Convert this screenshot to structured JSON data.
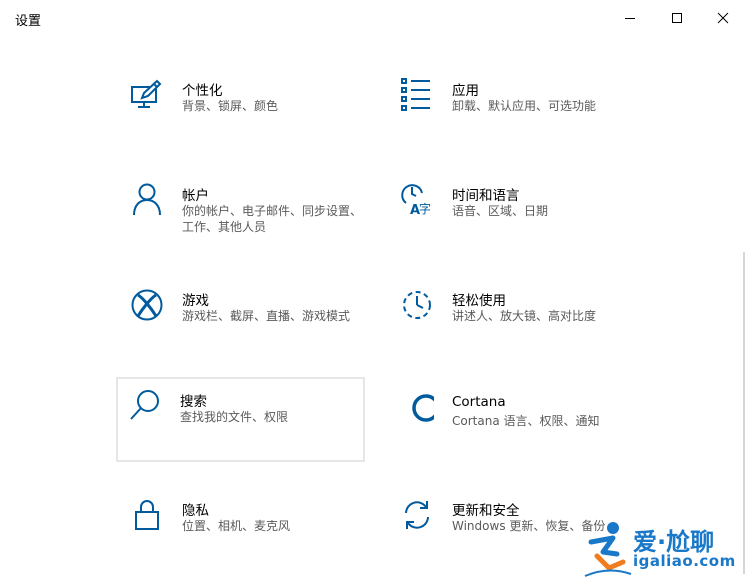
{
  "window": {
    "title": "设置",
    "minimize_icon": "minimize-icon",
    "maximize_icon": "maximize-icon",
    "close_icon": "close-icon"
  },
  "categories": [
    {
      "id": "personalization",
      "name": "个性化",
      "desc": "背景、锁屏、颜色",
      "icon": "personalization-icon"
    },
    {
      "id": "apps",
      "name": "应用",
      "desc": "卸载、默认应用、可选功能",
      "icon": "apps-icon"
    },
    {
      "id": "accounts",
      "name": "帐户",
      "desc": "你的帐户、电子邮件、同步设置、工作、其他人员",
      "icon": "account-icon"
    },
    {
      "id": "time-language",
      "name": "时间和语言",
      "desc": "语音、区域、日期",
      "icon": "time-language-icon"
    },
    {
      "id": "gaming",
      "name": "游戏",
      "desc": "游戏栏、截屏、直播、游戏模式",
      "icon": "xbox-icon"
    },
    {
      "id": "ease-of-access",
      "name": "轻松使用",
      "desc": "讲述人、放大镜、高对比度",
      "icon": "ease-of-access-icon"
    },
    {
      "id": "search",
      "name": "搜索",
      "desc": "查找我的文件、权限",
      "icon": "search-icon",
      "selected": true
    },
    {
      "id": "cortana",
      "name": "Cortana",
      "desc": "Cortana 语言、权限、通知",
      "icon": "cortana-icon"
    },
    {
      "id": "privacy",
      "name": "隐私",
      "desc": "位置、相机、麦克风",
      "icon": "lock-icon"
    },
    {
      "id": "update-security",
      "name": "更新和安全",
      "desc": "Windows 更新、恢复、备份",
      "icon": "sync-icon"
    }
  ],
  "watermark": {
    "line1": "爱·尬聊",
    "line2": "igaliao.com"
  },
  "colors": {
    "accent": "#005a9e",
    "text": "#000000",
    "secondary_text": "#5a5a5a",
    "selection_border": "#e6e6e6",
    "watermark": "#1a78c8",
    "watermark_orange": "#f07c1e"
  }
}
